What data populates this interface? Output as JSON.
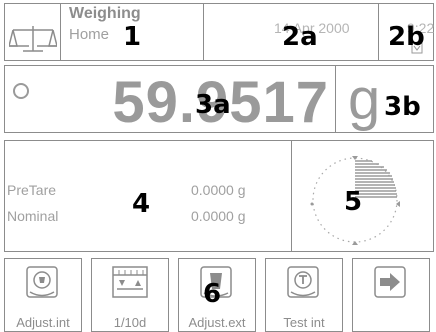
{
  "header": {
    "app_title": "Weighing",
    "app_subtitle": "Home",
    "date": "14 Apr 2000",
    "time": "9:22"
  },
  "weight": {
    "value": "59.9517",
    "unit": "g"
  },
  "info": {
    "rows": [
      {
        "label": "PreTare",
        "value": "0.0000 g"
      },
      {
        "label": "Nominal",
        "value": "0.0000 g"
      }
    ]
  },
  "softkeys": [
    {
      "label": "Adjust.int",
      "icon": "adjust-int-icon"
    },
    {
      "label": "1/10d",
      "icon": "resolution-icon"
    },
    {
      "label": "Adjust.ext",
      "icon": "adjust-ext-icon"
    },
    {
      "label": "Test int",
      "icon": "test-int-icon"
    },
    {
      "label": "",
      "icon": "arrow-right-icon"
    }
  ],
  "callouts": {
    "c1": "1",
    "c2a": "2a",
    "c2b": "2b",
    "c3a": "3a",
    "c3b": "3b",
    "c4": "4",
    "c5": "5",
    "c6": "6"
  },
  "colors": {
    "border": "#8c8c8c",
    "text": "#9a9a9a",
    "callout": "#000000"
  }
}
